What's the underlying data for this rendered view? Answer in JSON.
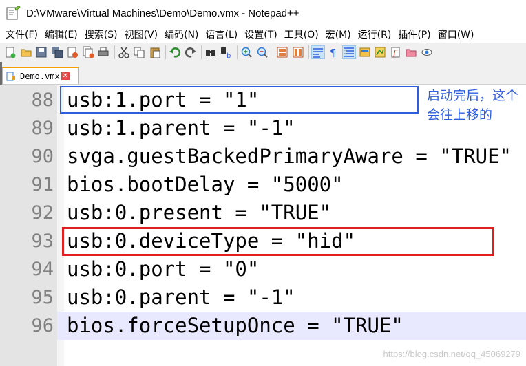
{
  "window": {
    "title": "D:\\VMware\\Virtual Machines\\Demo\\Demo.vmx - Notepad++",
    "app_icon": "notepad-plus-plus-icon"
  },
  "menu": [
    "文件(F)",
    "编辑(E)",
    "搜索(S)",
    "视图(V)",
    "编码(N)",
    "语言(L)",
    "设置(T)",
    "工具(O)",
    "宏(M)",
    "运行(R)",
    "插件(P)",
    "窗口(W)"
  ],
  "toolbar": [
    "new-file-icon",
    "open-file-icon",
    "save-icon",
    "save-all-icon",
    "close-icon",
    "close-all-icon",
    "print-icon",
    "|",
    "cut-icon",
    "copy-icon",
    "paste-icon",
    "|",
    "undo-icon",
    "redo-icon",
    "|",
    "find-icon",
    "replace-icon",
    "|",
    "zoom-in-icon",
    "zoom-out-icon",
    "|",
    "sync-vertical-icon",
    "sync-horizontal-icon",
    "|",
    "word-wrap-icon",
    "show-all-chars-icon",
    "indent-guide-icon",
    "user-lang-icon",
    "doc-map-icon",
    "function-list-icon",
    "folder-workspace-icon",
    "monitor-icon"
  ],
  "tab": {
    "label": "Demo.vmx",
    "close": "✕"
  },
  "editor": {
    "lines": [
      {
        "num": "88",
        "text": "usb:1.port = \"1\""
      },
      {
        "num": "89",
        "text": "usb:1.parent = \"-1\""
      },
      {
        "num": "90",
        "text": "svga.guestBackedPrimaryAware = \"TRUE\""
      },
      {
        "num": "91",
        "text": "bios.bootDelay = \"5000\""
      },
      {
        "num": "92",
        "text": "usb:0.present = \"TRUE\""
      },
      {
        "num": "93",
        "text": "usb:0.deviceType = \"hid\""
      },
      {
        "num": "94",
        "text": "usb:0.port = \"0\""
      },
      {
        "num": "95",
        "text": "usb:0.parent = \"-1\""
      },
      {
        "num": "96",
        "text": "bios.forceSetupOnce = \"TRUE\""
      }
    ],
    "current_line": "96"
  },
  "annotation": {
    "text": "启动完后，这个会往上移的",
    "color": "#2e5ee0"
  },
  "highlight_colors": {
    "blue_box": "#2e5ee0",
    "red_box": "#e02020"
  },
  "watermark": "https://blog.csdn.net/qq_45069279"
}
